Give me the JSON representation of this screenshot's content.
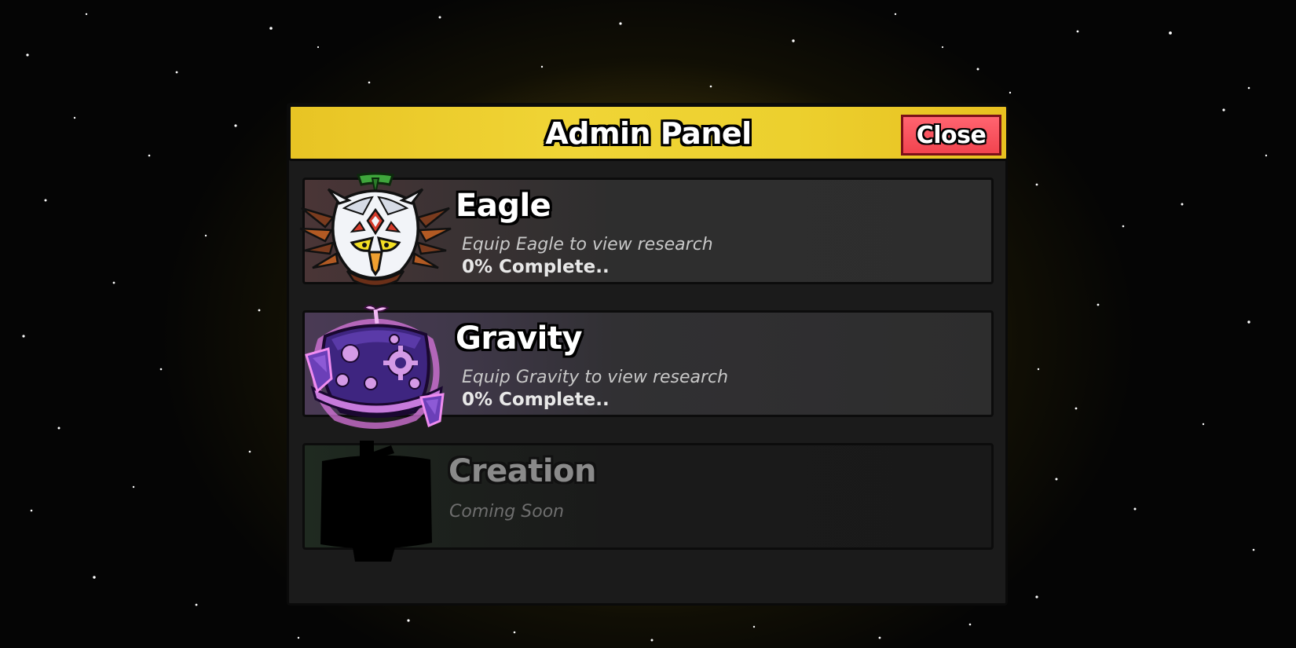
{
  "panel": {
    "title": "Admin Panel",
    "close_label": "Close"
  },
  "research_items": [
    {
      "name": "Eagle",
      "description": "Equip Eagle to view research",
      "progress_text": "0% Complete..",
      "progress": 0,
      "icon": "eagle-fruit-icon",
      "locked": false
    },
    {
      "name": "Gravity",
      "description": "Equip Gravity to view research",
      "progress_text": "0% Complete..",
      "progress": 0,
      "icon": "gravity-fruit-icon",
      "locked": false
    },
    {
      "name": "Creation",
      "description": "Coming Soon",
      "icon": "locked-silhouette-icon",
      "locked": true
    }
  ],
  "colors": {
    "header_gold": "#f0d536",
    "close_red": "#f2444f",
    "panel_bg": "#1b1b1b",
    "background_glow": "#786410"
  }
}
